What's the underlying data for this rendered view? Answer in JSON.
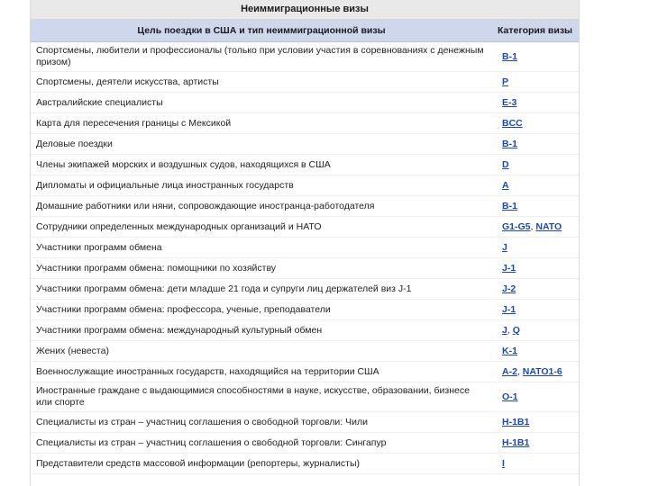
{
  "title": "Неиммиграционные визы",
  "headers": {
    "purpose": "Цель поездки в США и тип неиммиграционной визы",
    "category": "Категория визы"
  },
  "rows": [
    {
      "purpose": "Спортсмены, любители и профессионалы (только при условии участия в соревнованиях с денежным призом)",
      "links": [
        "B-1"
      ]
    },
    {
      "purpose": "Спортсмены, деятели искусства, артисты",
      "links": [
        "P"
      ]
    },
    {
      "purpose": "Австралийские специалисты",
      "links": [
        "E-3"
      ]
    },
    {
      "purpose": "Карта для пересечения границы с Мексикой",
      "links": [
        "BCC"
      ]
    },
    {
      "purpose": "Деловые поездки",
      "links": [
        "B-1"
      ]
    },
    {
      "purpose": "Члены экипажей морских и воздушных судов, находящихся в США",
      "links": [
        "D"
      ]
    },
    {
      "purpose": "Дипломаты и официальные лица иностранных государств",
      "links": [
        "A"
      ]
    },
    {
      "purpose": "Домашние работники или няни, сопровождающие иностранца-работодателя",
      "links": [
        "B-1"
      ]
    },
    {
      "purpose": "Сотрудники определенных международных организаций и НАТО",
      "links": [
        "G1-G5",
        "NATO"
      ]
    },
    {
      "purpose": "Участники программ обмена",
      "links": [
        "J"
      ]
    },
    {
      "purpose": "Участники программ обмена: помощники по хозяйству",
      "links": [
        "J-1"
      ]
    },
    {
      "purpose": "Участники программ обмена: дети младше 21 года и супруги лиц держателей виз J-1",
      "links": [
        "J-2"
      ]
    },
    {
      "purpose": "Участники программ обмена: профессора, ученые, преподаватели",
      "links": [
        "J-1"
      ]
    },
    {
      "purpose": "Участники программ обмена: международный культурный обмен",
      "links": [
        "J",
        "Q"
      ]
    },
    {
      "purpose": "Жених (невеста)",
      "links": [
        "K-1"
      ]
    },
    {
      "purpose": "Военнослужащие иностранных государств, находящийся на территории США",
      "links": [
        "A-2",
        "NATO1-6"
      ]
    },
    {
      "purpose": "Иностранные граждане с выдающимися способностями в науке, искусстве, образовании, бизнесе или спорте",
      "links": [
        "O-1"
      ]
    },
    {
      "purpose": "Специалисты из стран – участниц соглашения о свободной торговли: Чили",
      "links": [
        "H-1B1"
      ]
    },
    {
      "purpose": "Специалисты из стран – участниц соглашения о свободной торговли: Сингапур",
      "links": [
        "H-1B1"
      ]
    },
    {
      "purpose": "Представители средств массовой информации (репортеры, журналисты)",
      "links": [
        "I"
      ]
    }
  ]
}
